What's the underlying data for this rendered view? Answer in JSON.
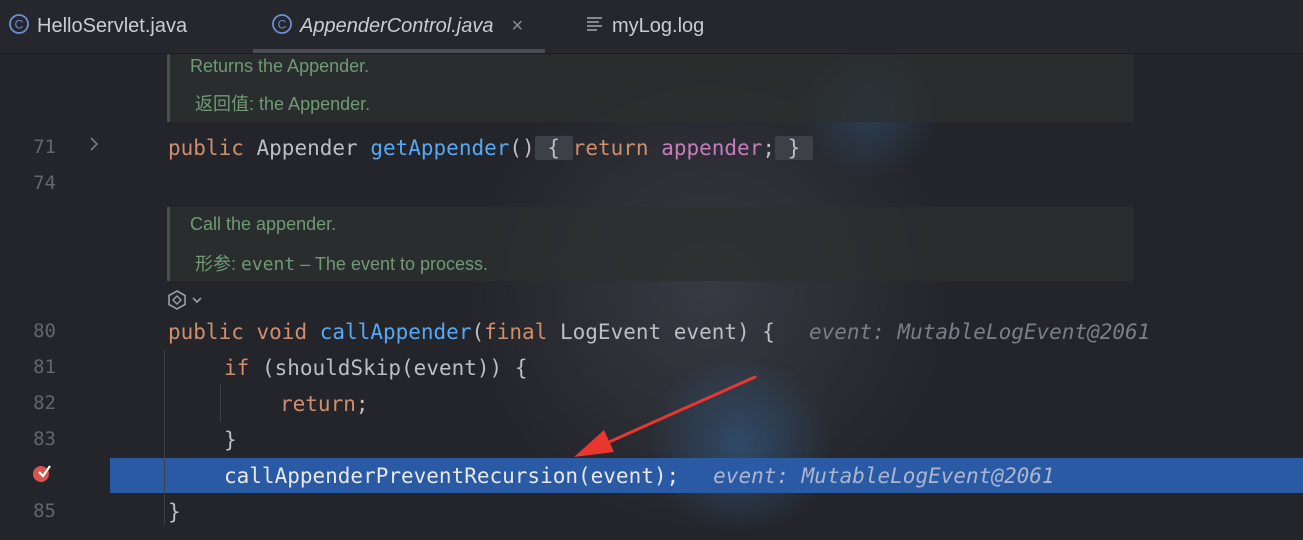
{
  "tabs": [
    {
      "label": "HelloServlet.java",
      "icon": "class-c-icon"
    },
    {
      "label": "AppenderControl.java",
      "icon": "class-c-icon",
      "active": true,
      "close": "×"
    },
    {
      "label": "myLog.log",
      "icon": "text-file-icon"
    }
  ],
  "doc1": {
    "line1": "Returns the Appender.",
    "label": "返回值:",
    "value": "the Appender."
  },
  "doc2": {
    "line1": "Call the appender.",
    "label": "形参:",
    "param": "event",
    "value": "– The event to process."
  },
  "line_numbers": {
    "l71": "71",
    "l74": "74",
    "l80": "80",
    "l81": "81",
    "l82": "82",
    "l83": "83",
    "l85": "85"
  },
  "code": {
    "l71": {
      "kw1": "public",
      "type": "Appender",
      "fn": "getAppender",
      "paren": "()",
      "brace_open": "{",
      "kw2": "return",
      "fld": "appender",
      "semi": ";",
      "brace_close": "}"
    },
    "l80": {
      "kw1": "public",
      "kw2": "void",
      "fn": "callAppender",
      "open": "(",
      "kw3": "final",
      "rest": "LogEvent event) {",
      "hint": "event: MutableLogEvent@2061"
    },
    "l81": {
      "kw": "if",
      "rest": "(shouldSkip(event)) {"
    },
    "l82": {
      "kw": "return",
      "rest": ";"
    },
    "l83": {
      "text": "}"
    },
    "l84": {
      "text": "callAppenderPreventRecursion(event);",
      "hint": "event: MutableLogEvent@2061"
    },
    "l85": {
      "text": "}"
    }
  },
  "colors": {
    "keyword": "#cf8e6d",
    "function": "#56a8f5",
    "field": "#c77dbb",
    "execution_line": "#2b5aa5",
    "annotation_arrow": "#e8372f"
  }
}
